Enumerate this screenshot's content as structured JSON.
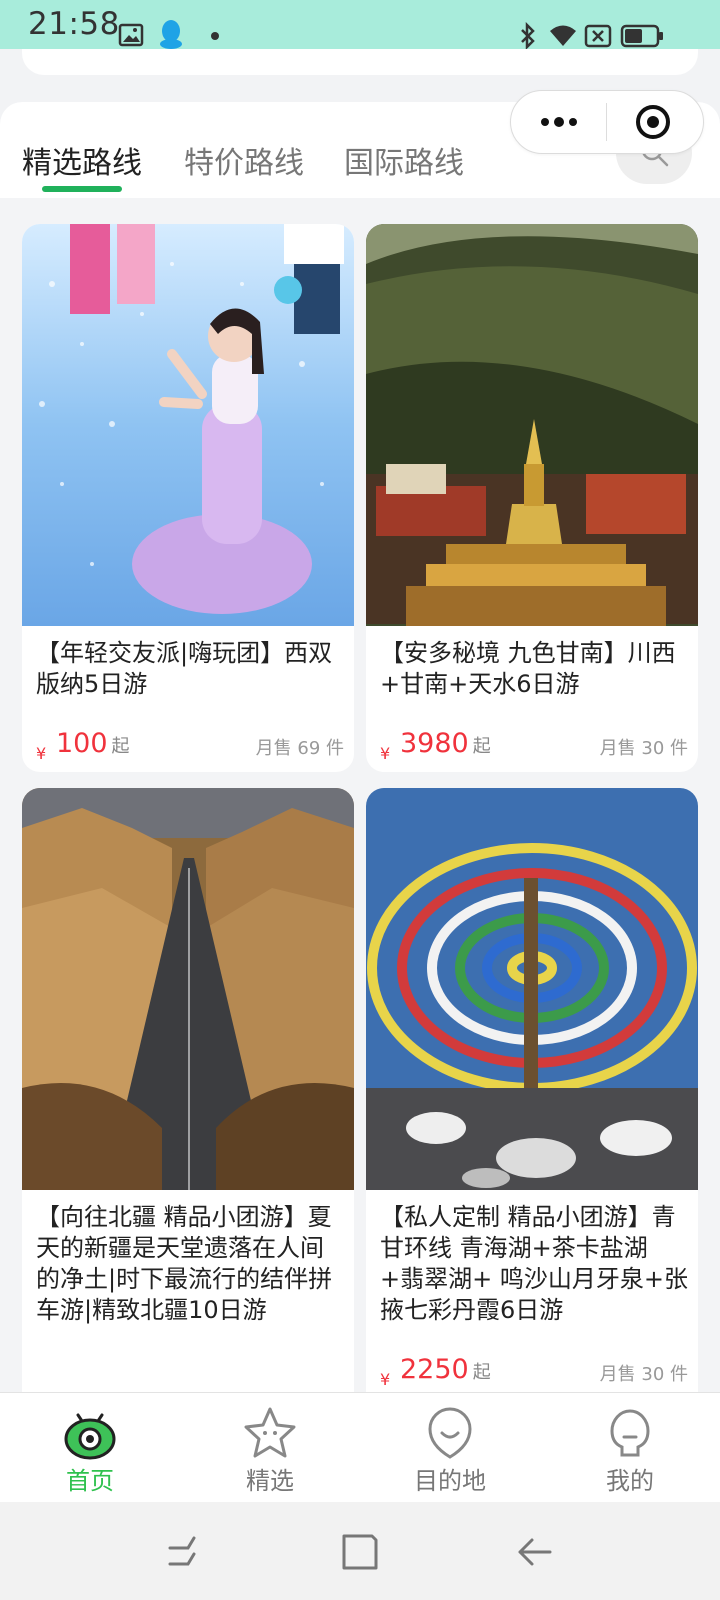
{
  "status_bar": {
    "time": "21:58",
    "icons": [
      "gallery-icon",
      "qq-penguin-icon",
      "dot-icon",
      "bluetooth-icon",
      "wifi-icon",
      "no-sim-icon",
      "battery-icon"
    ]
  },
  "capsule": {
    "more_icon": "more-dots-icon",
    "close_icon": "target-close-icon"
  },
  "tabs": [
    {
      "label": "精选路线",
      "active": true
    },
    {
      "label": "特价路线",
      "active": false
    },
    {
      "label": "国际路线",
      "active": false
    }
  ],
  "colors": {
    "accent_green": "#20b15b",
    "price_red": "#f0323c",
    "status_bar_bg": "#a8ecdb",
    "nav_active": "#2fc14e"
  },
  "products": [
    {
      "title": "【年轻交友派|嗨玩团】西双版纳5日游",
      "currency": "¥",
      "price": "100",
      "price_suffix": "起",
      "sales": "月售 69 件",
      "image": "woman-splashing-water-photo"
    },
    {
      "title": "【安多秘境 九色甘南】川西+甘南+天水6日游",
      "currency": "¥",
      "price": "3980",
      "price_suffix": "起",
      "sales": "月售 30 件",
      "image": "tibetan-temple-mountain-photo"
    },
    {
      "title": "【向往北疆 精品小团游】夏天的新疆是天堂遗落在人间的净土|时下最流行的结伴拼车游|精致北疆10日游",
      "currency": "",
      "price": "",
      "price_suffix": "",
      "sales": "",
      "image": "desert-road-canyon-photo"
    },
    {
      "title": "【私人定制 精品小团游】青甘环线 青海湖+茶卡盐湖+翡翠湖+ 鸣沙山月牙泉+张掖七彩丹霞6日游",
      "currency": "¥",
      "price": "2250",
      "price_suffix": "起",
      "sales": "月售 30 件",
      "image": "prayer-flags-pole-photo"
    }
  ],
  "bottom_nav": [
    {
      "label": "首页",
      "icon": "home-eye-icon",
      "active": true
    },
    {
      "label": "精选",
      "icon": "star-face-icon",
      "active": false
    },
    {
      "label": "目的地",
      "icon": "smile-face-icon",
      "active": false
    },
    {
      "label": "我的",
      "icon": "profile-face-icon",
      "active": false
    }
  ],
  "system_nav": [
    "recents-icon",
    "home-square-icon",
    "back-arrow-icon"
  ]
}
